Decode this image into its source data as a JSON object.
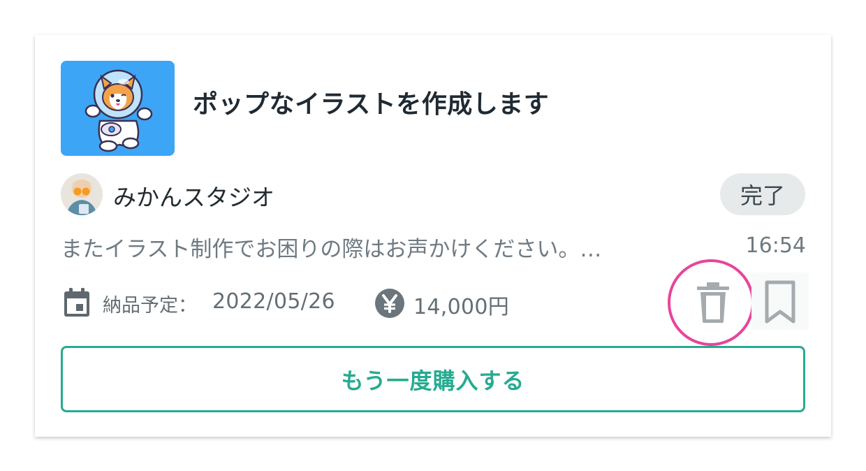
{
  "order": {
    "title": "ポップなイラストを作成します",
    "thumbnail_icon": "corgi-astronaut-illustration",
    "seller_name": "みかんスタジオ",
    "status": "完了",
    "last_message": "またイラスト制作でお困りの際はお声かけください。…",
    "message_time": "16:54",
    "delivery_label": "納品予定：",
    "delivery_date": "2022/05/26",
    "price": "14,000円",
    "rebuy_label": "もう一度購入する"
  },
  "icons": {
    "calendar": "calendar-icon",
    "yen": "yen-icon",
    "delete": "trash-icon",
    "bookmark": "bookmark-icon"
  },
  "colors": {
    "accent": "#26ab91",
    "highlight": "#e8449a",
    "thumbnail_bg": "#3ca5f5",
    "badge_bg": "#e7eaeb",
    "muted_text": "#6e7a82",
    "icon_gray": "#a4aaae"
  }
}
